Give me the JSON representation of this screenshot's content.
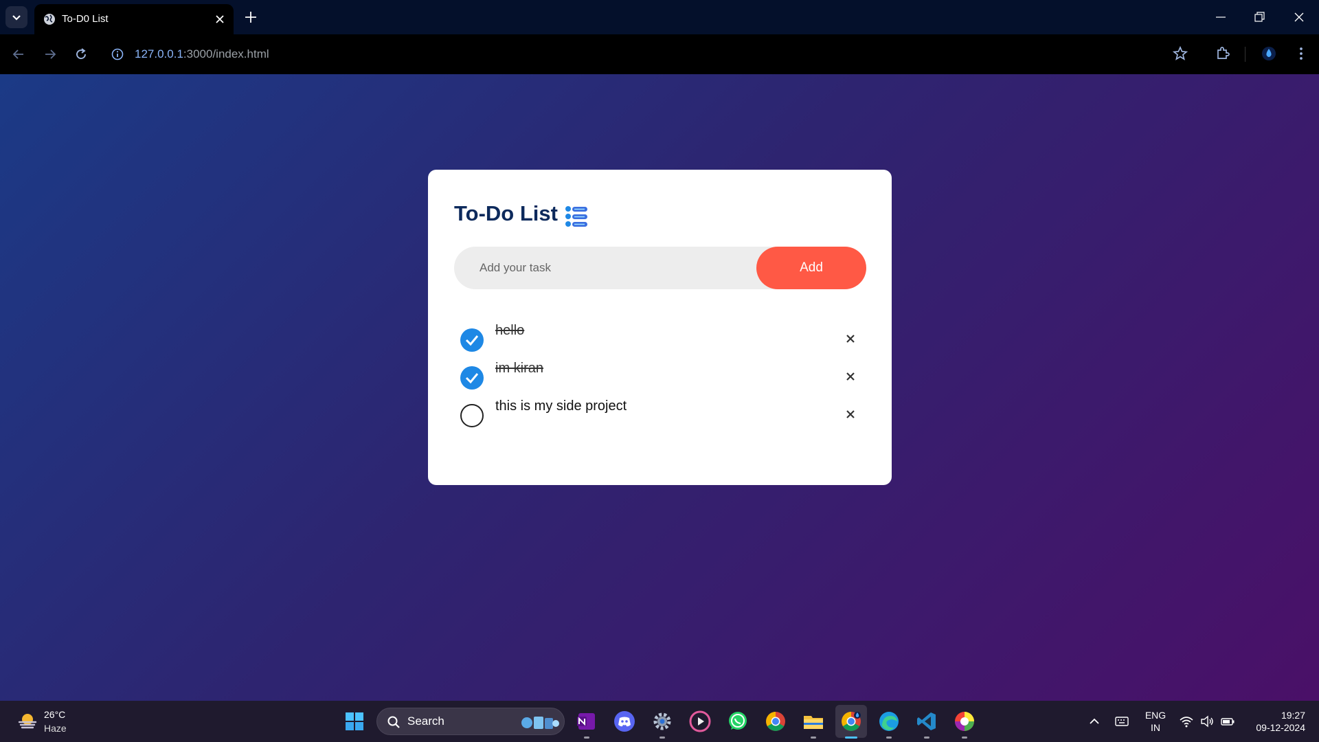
{
  "browser": {
    "tab_title": "To-D0 List",
    "url_host": "127.0.0.1",
    "url_path": ":3000/index.html"
  },
  "app": {
    "title": "To-Do List",
    "input_placeholder": "Add your task",
    "add_label": "Add",
    "tasks": [
      {
        "text": "hello",
        "done": true
      },
      {
        "text": "im kiran",
        "done": true
      },
      {
        "text": "this is my side project",
        "done": false
      }
    ]
  },
  "taskbar": {
    "weather_temp": "26°C",
    "weather_condition": "Haze",
    "search_label": "Search",
    "lang_top": "ENG",
    "lang_bottom": "IN",
    "time": "19:27",
    "date": "09-12-2024"
  },
  "colors": {
    "accent": "#ff5945",
    "check": "#1e88e5",
    "title": "#0d2a5c"
  }
}
